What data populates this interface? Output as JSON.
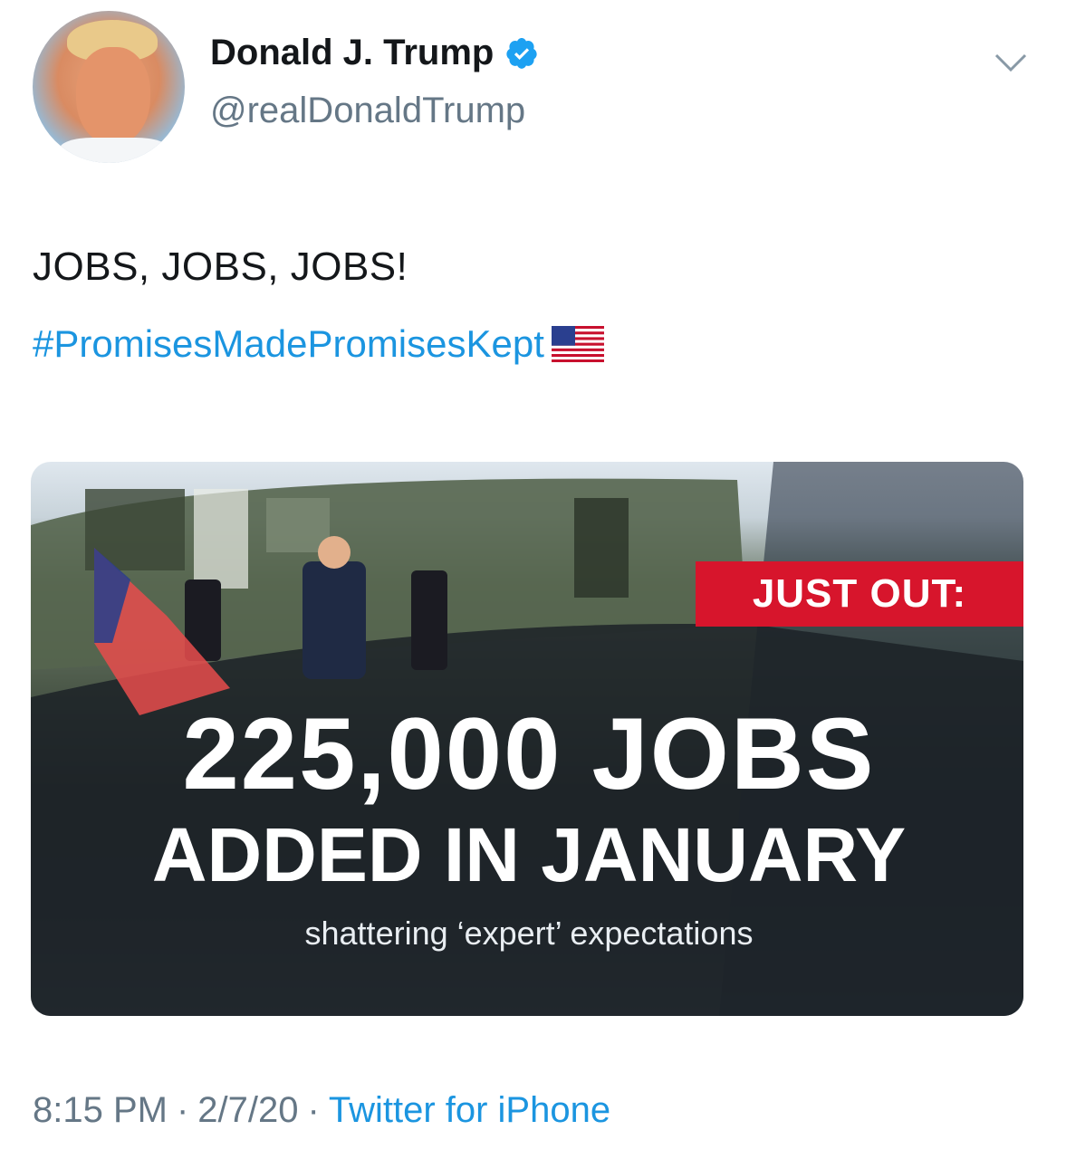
{
  "author": {
    "name": "Donald J. Trump",
    "handle": "@realDonaldTrump",
    "verified_icon": "verified-badge-icon",
    "menu_icon": "chevron-down-icon"
  },
  "tweet": {
    "text": "JOBS, JOBS, JOBS!",
    "hashtag": "#PromisesMadePromisesKept",
    "emoji": "us-flag-icon"
  },
  "media": {
    "badge": "JUST OUT:",
    "headline_1": "225,000 JOBS",
    "headline_2": "ADDED IN JANUARY",
    "subline": "shattering ‘expert’ expectations"
  },
  "footer": {
    "time": "8:15 PM",
    "date": "2/7/20",
    "source": "Twitter for iPhone",
    "separator": "·"
  },
  "colors": {
    "link": "#1b95e0",
    "muted": "#657786",
    "badge_red": "#d7152c"
  }
}
